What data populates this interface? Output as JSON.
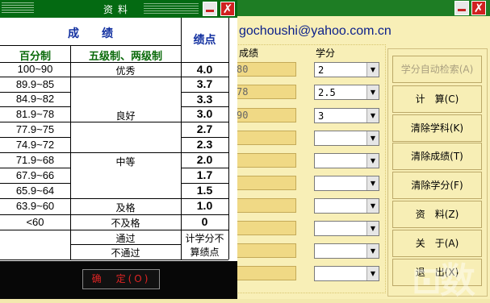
{
  "background_window": {
    "email": "gochoushi@yahoo.com.cn",
    "col_score": "成绩",
    "col_credit": "学分",
    "score_values": [
      "80",
      "78",
      "90",
      "",
      "",
      "",
      "",
      "",
      "",
      "",
      ""
    ],
    "credit_values": [
      "2",
      "2.5",
      "3",
      "",
      "",
      "",
      "",
      "",
      "",
      "",
      ""
    ],
    "buttons": [
      "学分自动检索(A)",
      "计　算(C)",
      "清除学科(K)",
      "清除成绩(T)",
      "清除学分(F)",
      "资　料(Z)",
      "关　于(A)",
      "退　出(X)"
    ]
  },
  "dialog": {
    "title": "资料",
    "header_score": "成　　绩",
    "header_points": "绩点",
    "col_percent": "百分制",
    "col_grade": "五级制、两级制",
    "rows": [
      {
        "pct": "100~90",
        "pts": "4.0"
      },
      {
        "pct": "89.9~85",
        "pts": "3.7"
      },
      {
        "pct": "84.9~82",
        "pts": "3.3"
      },
      {
        "pct": "81.9~78",
        "pts": "3.0"
      },
      {
        "pct": "77.9~75",
        "pts": "2.7"
      },
      {
        "pct": "74.9~72",
        "pts": "2.3"
      },
      {
        "pct": "71.9~68",
        "pts": "2.0"
      },
      {
        "pct": "67.9~66",
        "pts": "1.7"
      },
      {
        "pct": "65.9~64",
        "pts": "1.5"
      },
      {
        "pct": "63.9~60",
        "pts": "1.0"
      },
      {
        "pct": "<60",
        "pts": "0"
      }
    ],
    "grades": {
      "excellent": "优秀",
      "good": "良好",
      "medium": "中等",
      "pass": "及格",
      "fail": "不及格",
      "passed": "通过",
      "not_passed": "不通过"
    },
    "note_line1": "计学分不",
    "note_line2": "算绩点",
    "ok_button": "确　定(O)"
  }
}
